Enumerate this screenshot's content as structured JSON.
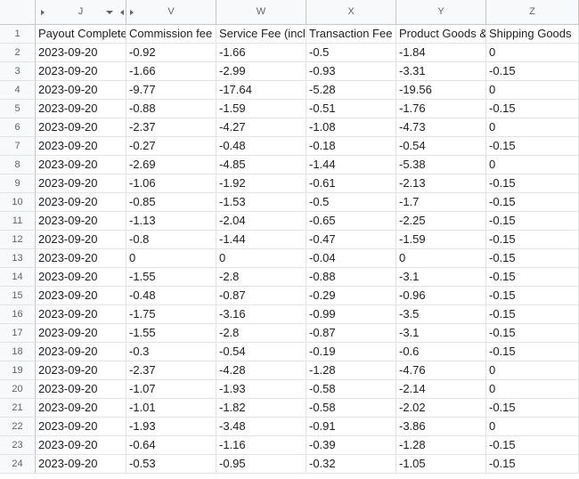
{
  "columns": [
    "J",
    "V",
    "W",
    "X",
    "Y",
    "Z"
  ],
  "header_row": {
    "row_number": "1",
    "cells": [
      "Payout Completed",
      "Commission fee",
      "Service Fee (incl",
      "Transaction Fee",
      "Product Goods &",
      "Shipping Goods"
    ]
  },
  "rows": [
    {
      "n": "2",
      "c": [
        "2023-09-20",
        "-0.92",
        "-1.66",
        "-0.5",
        "-1.84",
        "0"
      ]
    },
    {
      "n": "3",
      "c": [
        "2023-09-20",
        "-1.66",
        "-2.99",
        "-0.93",
        "-3.31",
        "-0.15"
      ]
    },
    {
      "n": "4",
      "c": [
        "2023-09-20",
        "-9.77",
        "-17.64",
        "-5.28",
        "-19.56",
        "0"
      ]
    },
    {
      "n": "5",
      "c": [
        "2023-09-20",
        "-0.88",
        "-1.59",
        "-0.51",
        "-1.76",
        "-0.15"
      ]
    },
    {
      "n": "6",
      "c": [
        "2023-09-20",
        "-2.37",
        "-4.27",
        "-1.08",
        "-4.73",
        "0"
      ]
    },
    {
      "n": "7",
      "c": [
        "2023-09-20",
        "-0.27",
        "-0.48",
        "-0.18",
        "-0.54",
        "-0.15"
      ]
    },
    {
      "n": "8",
      "c": [
        "2023-09-20",
        "-2.69",
        "-4.85",
        "-1.44",
        "-5.38",
        "0"
      ]
    },
    {
      "n": "9",
      "c": [
        "2023-09-20",
        "-1.06",
        "-1.92",
        "-0.61",
        "-2.13",
        "-0.15"
      ]
    },
    {
      "n": "10",
      "c": [
        "2023-09-20",
        "-0.85",
        "-1.53",
        "-0.5",
        "-1.7",
        "-0.15"
      ]
    },
    {
      "n": "11",
      "c": [
        "2023-09-20",
        "-1.13",
        "-2.04",
        "-0.65",
        "-2.25",
        "-0.15"
      ]
    },
    {
      "n": "12",
      "c": [
        "2023-09-20",
        "-0.8",
        "-1.44",
        "-0.47",
        "-1.59",
        "-0.15"
      ]
    },
    {
      "n": "13",
      "c": [
        "2023-09-20",
        "0",
        "0",
        "-0.04",
        "0",
        "-0.15"
      ]
    },
    {
      "n": "14",
      "c": [
        "2023-09-20",
        "-1.55",
        "-2.8",
        "-0.88",
        "-3.1",
        "-0.15"
      ]
    },
    {
      "n": "15",
      "c": [
        "2023-09-20",
        "-0.48",
        "-0.87",
        "-0.29",
        "-0.96",
        "-0.15"
      ]
    },
    {
      "n": "16",
      "c": [
        "2023-09-20",
        "-1.75",
        "-3.16",
        "-0.99",
        "-3.5",
        "-0.15"
      ]
    },
    {
      "n": "17",
      "c": [
        "2023-09-20",
        "-1.55",
        "-2.8",
        "-0.87",
        "-3.1",
        "-0.15"
      ]
    },
    {
      "n": "18",
      "c": [
        "2023-09-20",
        "-0.3",
        "-0.54",
        "-0.19",
        "-0.6",
        "-0.15"
      ]
    },
    {
      "n": "19",
      "c": [
        "2023-09-20",
        "-2.37",
        "-4.28",
        "-1.28",
        "-4.76",
        "0"
      ]
    },
    {
      "n": "20",
      "c": [
        "2023-09-20",
        "-1.07",
        "-1.93",
        "-0.58",
        "-2.14",
        "0"
      ]
    },
    {
      "n": "21",
      "c": [
        "2023-09-20",
        "-1.01",
        "-1.82",
        "-0.58",
        "-2.02",
        "-0.15"
      ]
    },
    {
      "n": "22",
      "c": [
        "2023-09-20",
        "-1.93",
        "-3.48",
        "-0.91",
        "-3.86",
        "0"
      ]
    },
    {
      "n": "23",
      "c": [
        "2023-09-20",
        "-0.64",
        "-1.16",
        "-0.39",
        "-1.28",
        "-0.15"
      ]
    },
    {
      "n": "24",
      "c": [
        "2023-09-20",
        "-0.53",
        "-0.95",
        "-0.32",
        "-1.05",
        "-0.15"
      ]
    }
  ]
}
